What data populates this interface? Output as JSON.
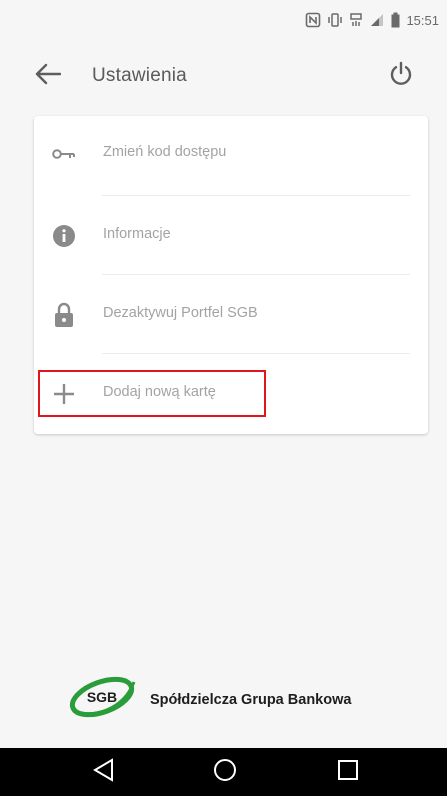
{
  "status_bar": {
    "time": "15:51",
    "icons": [
      "nfc-icon",
      "vibrate-icon",
      "data-signal-icon",
      "cellular-signal-icon",
      "battery-icon"
    ]
  },
  "app_bar": {
    "title": "Ustawienia",
    "back_icon": "arrow-left-icon",
    "power_icon": "power-icon"
  },
  "menu": {
    "items": [
      {
        "label": "Zmień kod dostępu",
        "icon": "key-icon"
      },
      {
        "label": "Informacje",
        "icon": "info-icon"
      },
      {
        "label": "Dezaktywuj Portfel SGB",
        "icon": "lock-icon"
      },
      {
        "label": "Dodaj nową kartę",
        "icon": "plus-icon"
      }
    ]
  },
  "logo": {
    "badge": "SGB",
    "text": "Spółdzielcza Grupa Bankowa"
  },
  "nav_bar": {
    "icons": [
      "back-triangle-icon",
      "home-circle-icon",
      "recents-square-icon"
    ]
  },
  "colors": {
    "background": "#f6f6f6",
    "card": "#ffffff",
    "label_text": "#a3a3a3",
    "icon_gray": "#8a8a8a",
    "highlight_red": "#e0161c",
    "logo_green": "#2a9d3a"
  }
}
